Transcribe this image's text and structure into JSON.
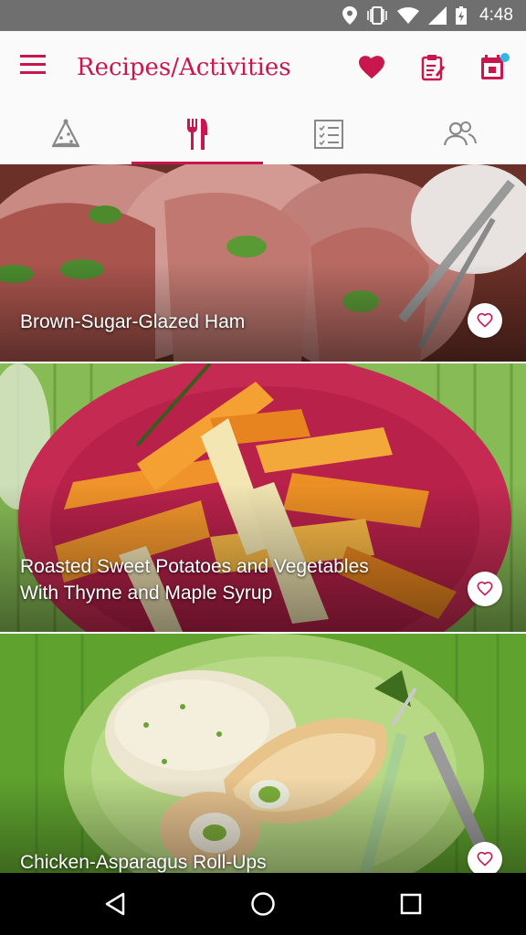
{
  "status_bar": {
    "time": "4:48",
    "icons": [
      "location-icon",
      "vibrate-icon",
      "wifi-icon",
      "signal-icon",
      "battery-charging-icon"
    ]
  },
  "app_bar": {
    "title": "Recipes/Activities",
    "actions": [
      "favorite-icon",
      "shopping-list-icon",
      "calendar-icon"
    ]
  },
  "tabs": [
    {
      "icon": "party-hat-icon",
      "selected": false
    },
    {
      "icon": "fork-knife-icon",
      "selected": true
    },
    {
      "icon": "checklist-icon",
      "selected": false
    },
    {
      "icon": "people-icon",
      "selected": false
    }
  ],
  "recipes": [
    {
      "title": "Brown-Sugar-Glazed Ham"
    },
    {
      "title": "Roasted Sweet Potatoes and Vegetables\nWith Thyme and Maple Syrup"
    },
    {
      "title": "Chicken-Asparagus Roll-Ups"
    }
  ],
  "nav_bar": [
    "back-icon",
    "home-icon",
    "recents-icon"
  ],
  "colors": {
    "accent": "#c8174e",
    "status_bar": "#6f6f6f"
  }
}
